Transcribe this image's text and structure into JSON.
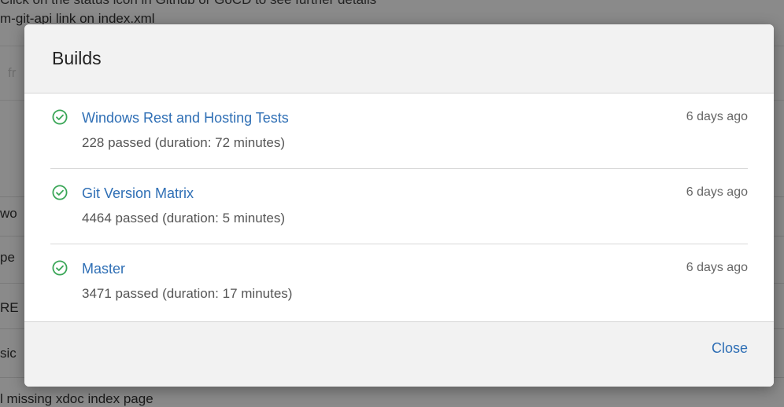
{
  "background": {
    "lines": [
      "Click on the status icon in Github or GoCD to see further details",
      "m-git-api link on index.xml",
      "fr",
      "wo",
      "pe",
      "RE",
      "sic",
      "l missing xdoc index page"
    ]
  },
  "modal": {
    "title": "Builds",
    "builds": [
      {
        "status": "success",
        "name": "Windows Rest and Hosting Tests",
        "detail": "228 passed (duration: 72 minutes)",
        "time": "6 days ago"
      },
      {
        "status": "success",
        "name": "Git Version Matrix",
        "detail": "4464 passed (duration: 5 minutes)",
        "time": "6 days ago"
      },
      {
        "status": "success",
        "name": "Master",
        "detail": "3471 passed (duration: 17 minutes)",
        "time": "6 days ago"
      }
    ],
    "close_label": "Close"
  },
  "colors": {
    "success": "#3aa657",
    "link": "#2f6fb5"
  }
}
